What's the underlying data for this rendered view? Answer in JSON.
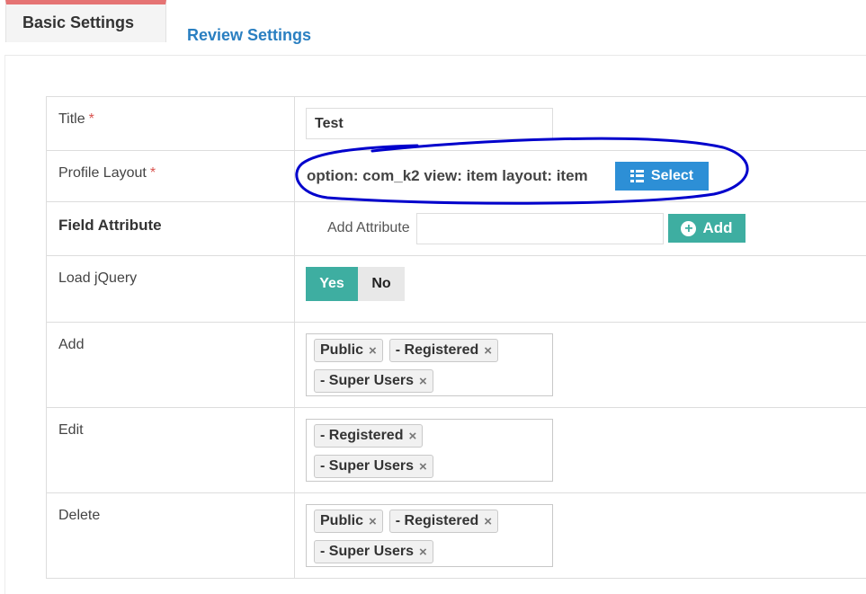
{
  "tabs": [
    {
      "label": "Basic Settings",
      "active": true
    },
    {
      "label": "Review Settings",
      "active": false
    }
  ],
  "fields": {
    "title": {
      "label": "Title",
      "required_mark": "*",
      "value": "Test"
    },
    "profile_layout": {
      "label": "Profile Layout",
      "required_mark": "*",
      "value": "option: com_k2 view: item layout: item",
      "button_label": "Select"
    },
    "field_attribute": {
      "label": "Field Attribute",
      "add_attribute_label": "Add Attribute",
      "input_value": "",
      "button_label": "Add"
    },
    "load_jquery": {
      "label": "Load jQuery",
      "yes": "Yes",
      "no": "No",
      "selected": "Yes"
    },
    "add": {
      "label": "Add",
      "tags": [
        "Public",
        "- Registered",
        "- Super Users"
      ]
    },
    "edit": {
      "label": "Edit",
      "tags": [
        "- Registered",
        "- Super Users"
      ]
    },
    "delete": {
      "label": "Delete",
      "tags": [
        "Public",
        "- Registered",
        "- Super Users"
      ]
    }
  },
  "icons": {
    "remove": "×",
    "select": "list-icon",
    "add": "plus-circle-icon"
  },
  "colors": {
    "active_tab_border": "#e57373",
    "link_tab": "#2a7fc1",
    "select_button": "#2d8fd6",
    "teal": "#3eaea1",
    "required": "#d9534f",
    "annotation": "#0000cc"
  }
}
